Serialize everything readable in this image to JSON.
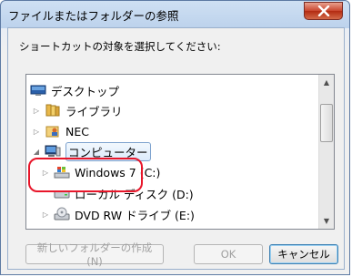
{
  "window": {
    "title": "ファイルまたはフォルダーの参照"
  },
  "dialog": {
    "prompt": "ショートカットの対象を選択してください:"
  },
  "tree": {
    "items": [
      {
        "label": "デスクトップ",
        "icon": "desktop-icon",
        "expander": ""
      },
      {
        "label": "ライブラリ",
        "icon": "library-icon",
        "expander": "▷"
      },
      {
        "label": "NEC",
        "icon": "user-folder-icon",
        "expander": "▷"
      },
      {
        "label": "コンピューター",
        "icon": "computer-icon",
        "expander": "◢",
        "selected": true
      },
      {
        "label": "Windows 7 (C:)",
        "icon": "windows-drive-icon",
        "expander": "▷"
      },
      {
        "label": "ローカル ディスク (D:)",
        "icon": "local-disk-icon",
        "expander": ""
      },
      {
        "label": "DVD RW ドライブ (E:)",
        "icon": "dvd-drive-icon",
        "expander": "▷"
      }
    ]
  },
  "buttons": {
    "new_folder": "新しいフォルダーの作成(N)",
    "ok": "OK",
    "cancel": "キャンセル"
  }
}
